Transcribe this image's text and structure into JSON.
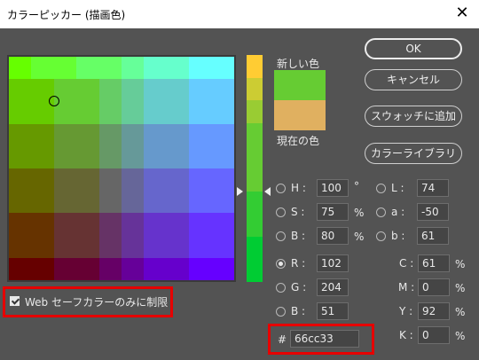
{
  "window": {
    "title": "カラーピッカー (描画色)",
    "close_glyph": "✕"
  },
  "field": {
    "colors": [
      [
        "#66ff00",
        "#66ff33",
        "#66ff66",
        "#66ff99",
        "#66ffcc",
        "#66ffff",
        "#66ffcc",
        "#66ff99",
        "#66ff66",
        "#66ffff"
      ],
      [
        "#66cc00",
        "#66cc33",
        "#66cc66",
        "#66cc99",
        "#66cccc",
        "#66ccff",
        "#66cccc",
        "#66cc99",
        "#66cc66",
        "#66ccff"
      ],
      [
        "#669900",
        "#669933",
        "#669966",
        "#669999",
        "#6699cc",
        "#6699ff",
        "#6699cc",
        "#669999",
        "#669966",
        "#6699ff"
      ],
      [
        "#666600",
        "#666633",
        "#666666",
        "#666699",
        "#6666cc",
        "#6666ff",
        "#6666cc",
        "#666699",
        "#666666",
        "#6666ff"
      ],
      [
        "#663300",
        "#663333",
        "#663366",
        "#663399",
        "#6633cc",
        "#6633ff",
        "#6633cc",
        "#663399",
        "#663366",
        "#6633ff"
      ],
      [
        "#660000",
        "#660033",
        "#660066",
        "#660099",
        "#6600cc",
        "#6600ff",
        "#6600cc",
        "#660099",
        "#660066",
        "#6600ff"
      ]
    ]
  },
  "slider": {
    "colors": [
      "#ffcc33",
      "#cccc33",
      "#99cc33",
      "#66cc33",
      "#66cc33",
      "#66cc33",
      "#33cc33",
      "#33cc33",
      "#00cc33",
      "#00cc33"
    ]
  },
  "swatches": {
    "new_label": "新しい色",
    "current_label": "現在の色",
    "new_color": "#66cc33",
    "current_color": "#e0b060"
  },
  "buttons": {
    "ok": "OK",
    "cancel": "キャンセル",
    "add_swatch": "スウォッチに追加",
    "libraries": "カラーライブラリ"
  },
  "hsb": {
    "h": {
      "label": "H :",
      "value": "100",
      "unit": "°"
    },
    "s": {
      "label": "S :",
      "value": "75",
      "unit": "%"
    },
    "b": {
      "label": "B :",
      "value": "80",
      "unit": "%"
    }
  },
  "lab": {
    "l": {
      "label": "L :",
      "value": "74"
    },
    "a": {
      "label": "a :",
      "value": "-50"
    },
    "b": {
      "label": "b :",
      "value": "61"
    }
  },
  "rgb": {
    "r": {
      "label": "R :",
      "value": "102"
    },
    "g": {
      "label": "G :",
      "value": "204"
    },
    "b": {
      "label": "B :",
      "value": "51"
    }
  },
  "cmyk": {
    "c": {
      "label": "C :",
      "value": "61",
      "unit": "%"
    },
    "m": {
      "label": "M :",
      "value": "0",
      "unit": "%"
    },
    "y": {
      "label": "Y :",
      "value": "92",
      "unit": "%"
    },
    "k": {
      "label": "K :",
      "value": "0",
      "unit": "%"
    }
  },
  "hex": {
    "label": "#",
    "value": "66cc33"
  },
  "websafe": {
    "label": "Web セーフカラーのみに制限",
    "checked": true
  },
  "colors": {
    "highlight": "#e60000",
    "background": "#535353"
  }
}
